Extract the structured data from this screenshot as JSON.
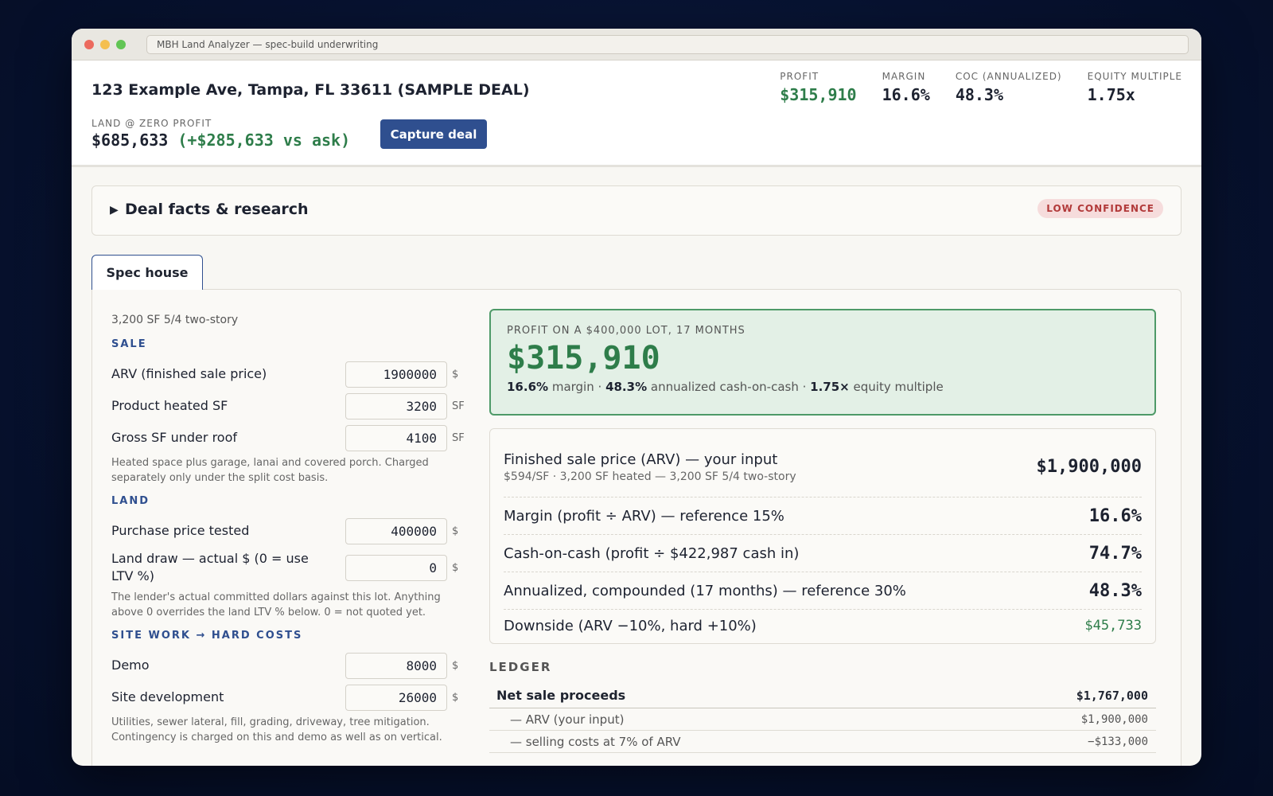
{
  "window": {
    "url": "MBH Land Analyzer — spec-build underwriting"
  },
  "header": {
    "deal_title": "123 Example Ave, Tampa, FL 33611 (SAMPLE DEAL)",
    "zero_profit_label": "LAND @ ZERO PROFIT",
    "zero_profit_value": "$685,633",
    "zero_profit_delta": "(+$285,633 vs ask)",
    "capture_label": "Capture deal",
    "kpis": [
      {
        "label": "PROFIT",
        "value": "$315,910"
      },
      {
        "label": "MARGIN",
        "value": "16.6%"
      },
      {
        "label": "COC (ANNUALIZED)",
        "value": "48.3%"
      },
      {
        "label": "EQUITY MULTIPLE",
        "value": "1.75x"
      }
    ],
    "colors": {
      "accent": "#2f4f8f",
      "positive": "#2e7d4a",
      "warning": "#b23a3a"
    }
  },
  "facts": {
    "caret": "▶",
    "title": "Deal facts & research",
    "badge": "LOW CONFIDENCE"
  },
  "tabs": [
    {
      "label": "Spec house"
    }
  ],
  "inputs": {
    "product": "3,200 SF 5/4 two-story",
    "sale": {
      "heading": "SALE",
      "fields": [
        {
          "label": "ARV (finished sale price)",
          "value": "1900000",
          "unit": "$"
        },
        {
          "label": "Product heated SF",
          "value": "3200",
          "unit": "SF"
        },
        {
          "label": "Gross SF under roof",
          "value": "4100",
          "unit": "SF"
        }
      ],
      "note": "Heated space plus garage, lanai and covered porch. Charged separately only under the split cost basis."
    },
    "land": {
      "heading": "LAND",
      "fields": [
        {
          "label": "Purchase price tested",
          "value": "400000",
          "unit": "$"
        },
        {
          "label": "Land draw — actual $ (0 = use LTV %)",
          "value": "0",
          "unit": "$"
        }
      ],
      "note": "The lender's actual committed dollars against this lot. Anything above 0 overrides the land LTV % below. 0 = not quoted yet."
    },
    "site": {
      "heading": "SITE WORK → HARD COSTS",
      "fields": [
        {
          "label": "Demo",
          "value": "8000",
          "unit": "$"
        },
        {
          "label": "Site development",
          "value": "26000",
          "unit": "$"
        }
      ],
      "note": "Utilities, sewer lateral, fill, grading, driveway, tree mitigation. Contingency is charged on this and demo as well as on vertical."
    }
  },
  "profit_card": {
    "label": "PROFIT ON A $400,000 LOT, 17 MONTHS",
    "value": "$315,910",
    "margin": "16.6%",
    "margin_text": "margin ·",
    "coc": "48.3%",
    "coc_text": "annualized cash-on-cash ·",
    "equity": "1.75×",
    "equity_text": "equity multiple"
  },
  "metrics": [
    {
      "label": "Finished sale price (ARV) — your input",
      "sub": "$594/SF · 3,200 SF heated — 3,200 SF 5/4 two-story",
      "value": "$1,900,000"
    },
    {
      "label": "Margin (profit ÷ ARV) — reference 15%",
      "value": "16.6%"
    },
    {
      "label": "Cash-on-cash (profit ÷ $422,987 cash in)",
      "value": "74.7%"
    },
    {
      "label": "Annualized, compounded (17 months) — reference 30%",
      "value": "48.3%"
    },
    {
      "label": "Downside (ARV −10%, hard +10%)",
      "value": "$45,733"
    }
  ],
  "ledger": {
    "heading": "LEDGER",
    "rows": [
      {
        "label": "Net sale proceeds",
        "value": "$1,767,000"
      },
      {
        "label": "— ARV (your input)",
        "value": "$1,900,000"
      },
      {
        "label": "— selling costs at 7% of ARV",
        "value": "−$133,000"
      }
    ]
  }
}
